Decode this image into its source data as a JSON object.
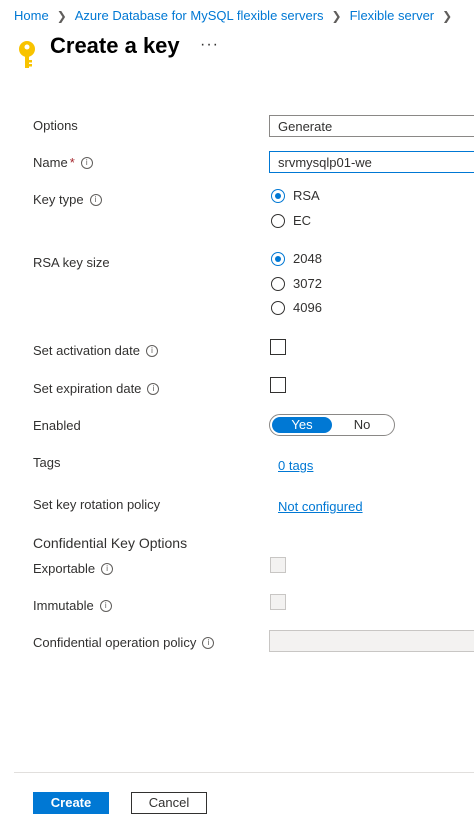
{
  "breadcrumb": [
    "Home",
    "Azure Database for MySQL flexible servers",
    "Flexible server"
  ],
  "header": {
    "title": "Create a key",
    "more": "···"
  },
  "form": {
    "options": {
      "label": "Options",
      "value": "Generate"
    },
    "name": {
      "label": "Name",
      "required": "*",
      "value": "srvmysqlp01-we"
    },
    "key_type": {
      "label": "Key type",
      "options": [
        "RSA",
        "EC"
      ],
      "selected": "RSA"
    },
    "rsa_key_size": {
      "label": "RSA key size",
      "options": [
        "2048",
        "3072",
        "4096"
      ],
      "selected": "2048"
    },
    "activation_date": {
      "label": "Set activation date",
      "checked": false
    },
    "expiration_date": {
      "label": "Set expiration date",
      "checked": false
    },
    "enabled": {
      "label": "Enabled",
      "yes": "Yes",
      "no": "No",
      "selected": "Yes"
    },
    "tags": {
      "label": "Tags",
      "link": "0 tags"
    },
    "rotation_policy": {
      "label": "Set key rotation policy",
      "link": "Not configured"
    },
    "confidential": {
      "heading": "Confidential Key Options",
      "exportable": {
        "label": "Exportable",
        "checked": false
      },
      "immutable": {
        "label": "Immutable",
        "checked": false
      },
      "operation_policy": {
        "label": "Confidential operation policy",
        "value": ""
      }
    }
  },
  "footer": {
    "create": "Create",
    "cancel": "Cancel"
  },
  "colors": {
    "accent": "#0078d4",
    "key_icon": "#f8c300",
    "required": "#a4262c"
  },
  "icons": {
    "key": "key-icon",
    "info": "info-icon",
    "chevron": "chevron-right-icon"
  }
}
